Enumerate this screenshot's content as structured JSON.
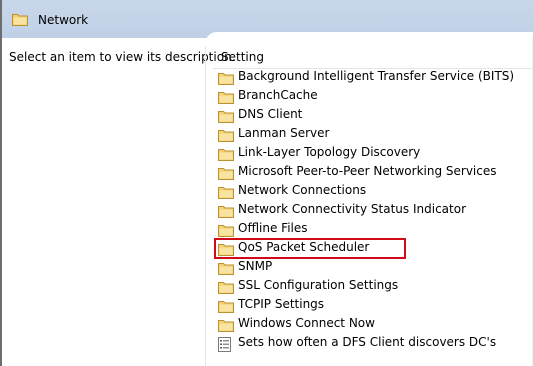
{
  "header": {
    "title": "Network",
    "icon": "folder-icon"
  },
  "description_pane": {
    "text": "Select an item to view its description."
  },
  "list": {
    "column_header": "Setting",
    "items": [
      {
        "label": "Background Intelligent Transfer Service (BITS)",
        "icon": "folder-icon"
      },
      {
        "label": "BranchCache",
        "icon": "folder-icon"
      },
      {
        "label": "DNS Client",
        "icon": "folder-icon"
      },
      {
        "label": "Lanman Server",
        "icon": "folder-icon"
      },
      {
        "label": "Link-Layer Topology Discovery",
        "icon": "folder-icon"
      },
      {
        "label": "Microsoft Peer-to-Peer Networking Services",
        "icon": "folder-icon"
      },
      {
        "label": "Network Connections",
        "icon": "folder-icon"
      },
      {
        "label": "Network Connectivity Status Indicator",
        "icon": "folder-icon"
      },
      {
        "label": "Offline Files",
        "icon": "folder-icon"
      },
      {
        "label": "QoS Packet Scheduler",
        "icon": "folder-icon",
        "highlighted": true
      },
      {
        "label": "SNMP",
        "icon": "folder-icon"
      },
      {
        "label": "SSL Configuration Settings",
        "icon": "folder-icon"
      },
      {
        "label": "TCPIP Settings",
        "icon": "folder-icon"
      },
      {
        "label": "Windows Connect Now",
        "icon": "folder-icon"
      },
      {
        "label": "Sets how often a DFS Client discovers DC's",
        "icon": "policy-setting-icon"
      }
    ]
  },
  "colors": {
    "header_background": "#c5d5e9",
    "highlight_border": "#d00b18",
    "folder_fill": "#f3d277",
    "folder_outline": "#b89234"
  }
}
